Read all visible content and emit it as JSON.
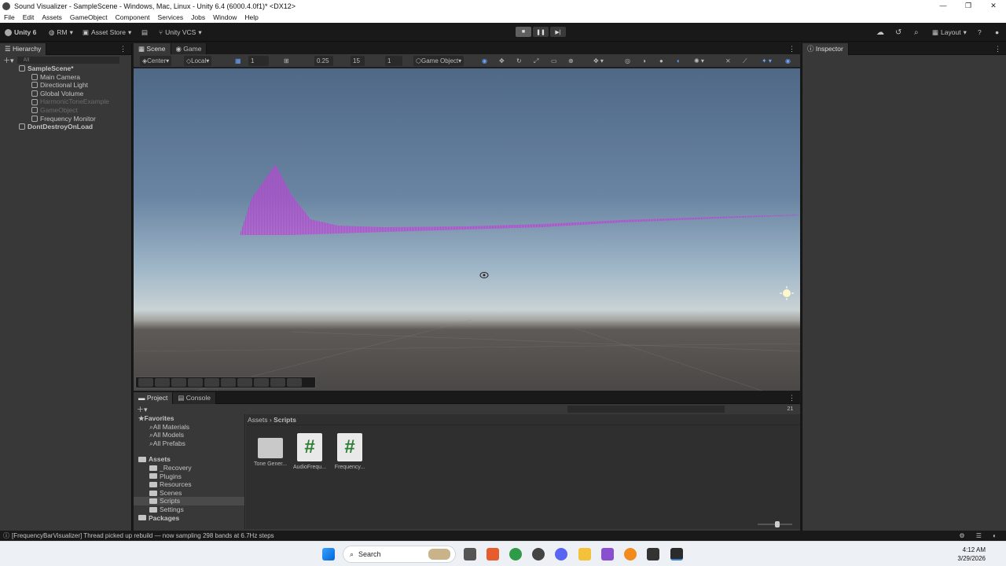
{
  "window": {
    "title": "Sound Visualizer - SampleScene - Windows, Mac, Linux - Unity 6.4 (6000.4.0f1)* <DX12>",
    "min": "—",
    "max": "❐",
    "close": "✕"
  },
  "menu": [
    "File",
    "Edit",
    "Assets",
    "GameObject",
    "Component",
    "Services",
    "Jobs",
    "Window",
    "Help"
  ],
  "toolbar": {
    "unity": "Unity 6",
    "account": "RM",
    "asset_store": "Asset Store",
    "vcs": "Unity VCS",
    "layout": "Layout"
  },
  "hierarchy": {
    "tab": "Hierarchy",
    "search_placeholder": "All",
    "items": [
      {
        "label": "SampleScene*",
        "level": 0,
        "dim": false
      },
      {
        "label": "Main Camera",
        "level": 1,
        "dim": false
      },
      {
        "label": "Directional Light",
        "level": 1,
        "dim": false
      },
      {
        "label": "Global Volume",
        "level": 1,
        "dim": false
      },
      {
        "label": "HarmonicToneExample",
        "level": 1,
        "dim": true
      },
      {
        "label": "GameObject",
        "level": 1,
        "dim": true
      },
      {
        "label": "Frequency Monitor",
        "level": 1,
        "dim": false
      },
      {
        "label": "DontDestroyOnLoad",
        "level": 0,
        "dim": false
      }
    ]
  },
  "scene": {
    "tabs": [
      "Scene",
      "Game"
    ],
    "pivot": "Center",
    "space": "Local",
    "grid_size": "1",
    "snap_increment": "0.25",
    "rotate_snap": "15",
    "scale_snap": "1",
    "draw_mode": "Game Object"
  },
  "inspector": {
    "tab": "Inspector"
  },
  "project": {
    "tabs": [
      "Project",
      "Console"
    ],
    "favorites_label": "Favorites",
    "favorites": [
      "All Materials",
      "All Models",
      "All Prefabs"
    ],
    "assets_label": "Assets",
    "asset_folders": [
      "_Recovery",
      "Plugins",
      "Resources",
      "Scenes",
      "Scripts",
      "Settings"
    ],
    "packages_label": "Packages",
    "breadcrumb": [
      "Assets",
      "Scripts"
    ],
    "hidden_count": "21",
    "files": [
      {
        "name": "Tone Gener...",
        "kind": "folder"
      },
      {
        "name": "AudioFrequ...",
        "kind": "script"
      },
      {
        "name": "Frequency...",
        "kind": "script"
      }
    ]
  },
  "status": {
    "message": "[FrequencyBarVisualizer] Thread picked up rebuild — now sampling 298 bands at 6.7Hz steps"
  },
  "taskbar": {
    "search": "Search",
    "time": "4:12 AM",
    "date": "3/29/2026"
  },
  "colors": {
    "visualizer": "#c040d8",
    "accent": "#3c7fd1"
  }
}
